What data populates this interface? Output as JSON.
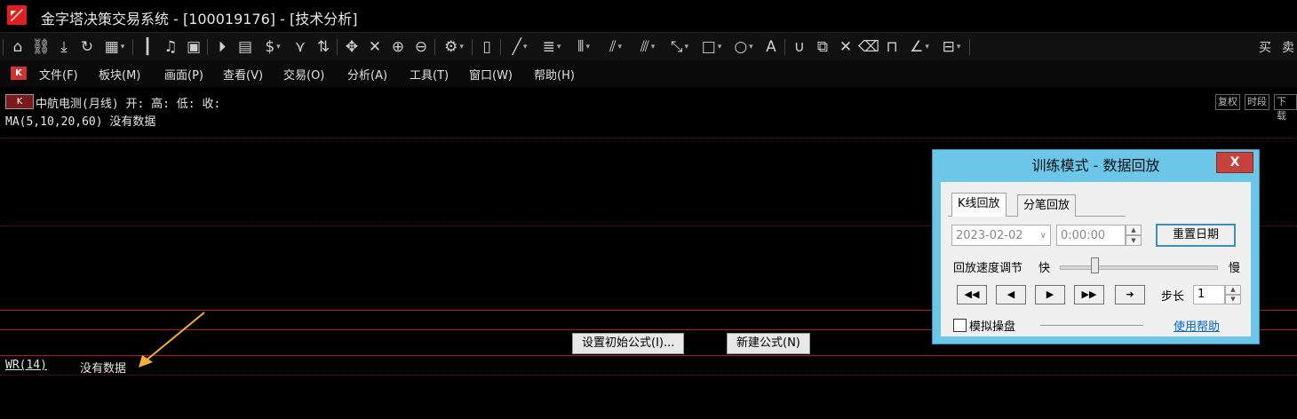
{
  "window": {
    "title": "金字塔决策交易系统 - [100019176] - [技术分析]"
  },
  "toolbar": {
    "icons": [
      "home-icon",
      "link-icon",
      "download-icon",
      "refresh-icon",
      "grid-icon",
      "candlestick-icon",
      "bell-icon",
      "chart-icon",
      "play-icon",
      "document-icon",
      "dollar-icon",
      "filter-icon",
      "sort-icon",
      "move-icon",
      "cross-icon",
      "zoom-in-icon",
      "zoom-out-icon",
      "settings-icon",
      "mouse-icon",
      "line-icon",
      "fib-icon",
      "vertical-lines-icon",
      "fan-icon",
      "parallel-icon",
      "diagonal-icon",
      "rectangle-icon",
      "circle-icon",
      "text-icon",
      "magnet-icon",
      "copy-icon",
      "delete-icon",
      "trash-icon",
      "lock-icon",
      "angle-icon",
      "save-icon"
    ],
    "buy_label": "买",
    "sell_label": "卖"
  },
  "menu": {
    "items": [
      "文件(F)",
      "板块(M)",
      "画面(P)",
      "查看(V)",
      "交易(O)",
      "分析(A)",
      "工具(T)",
      "窗口(W)",
      "帮助(H)"
    ]
  },
  "chart": {
    "kline_badge": "K",
    "security_line": "中航电测(月线) 开: 高: 低: 收:",
    "ma_line": "MA(5,10,20,60)   没有数据",
    "right_buttons": [
      "复权",
      "时段",
      "下载"
    ],
    "wr_label": "WR(14)",
    "wr_status": "没有数据",
    "set_formula_button": "设置初始公式(I)...",
    "new_formula_button": "新建公式(N)"
  },
  "dialog": {
    "title": "训练模式 - 数据回放",
    "close": "X",
    "tabs": [
      "K线回放",
      "分笔回放"
    ],
    "date_value": "2023-02-02",
    "time_value": "0:00:00",
    "reset_date_button": "重置日期",
    "speed_label": "回放速度调节",
    "fast_label": "快",
    "slow_label": "慢",
    "speed_level": 0.2,
    "step_label": "步长",
    "step_value": "1",
    "simulate_label": "模拟操盘",
    "help_link": "使用帮助"
  },
  "colors": {
    "accent": "#6cc6e8",
    "grid_red": "#b01818",
    "annotation_arrow": "#f5b02e",
    "link": "#0066cc"
  }
}
